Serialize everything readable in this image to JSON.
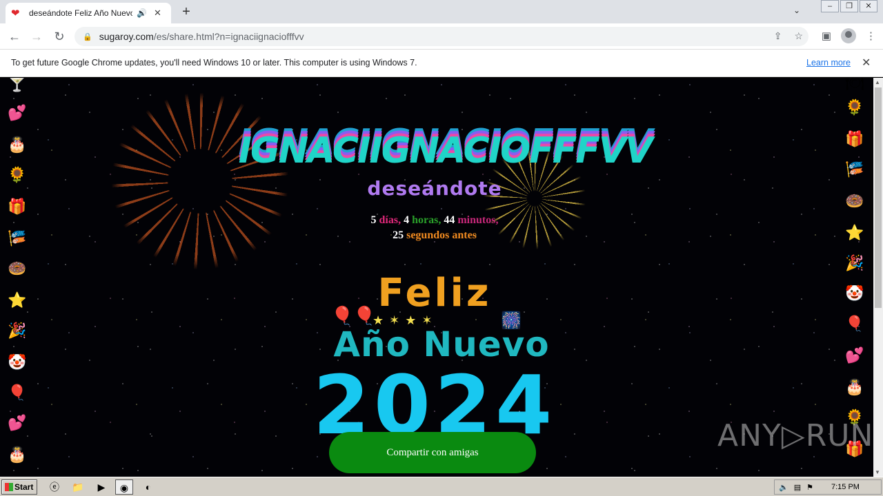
{
  "browser": {
    "tab_title": "deseándote Feliz Año Nuevo 20",
    "url_host": "sugaroy.com",
    "url_path": "/es/share.html?n=ignaciignaciofffvv"
  },
  "infobar": {
    "message": "To get future Google Chrome updates, you'll need Windows 10 or later. This computer is using Windows 7.",
    "link": "Learn more"
  },
  "page": {
    "headline": "IGNACIIGNACIOFFFVV",
    "subhead": "deseándote",
    "countdown": {
      "days": "5",
      "days_label": "días,",
      "hours": "4",
      "hours_label": "horas,",
      "minutes": "44",
      "minutes_label": "minutos,",
      "seconds": "25",
      "seconds_label": "segundos antes"
    },
    "greeting_line1": "Feliz",
    "greeting_line2": "Año Nuevo",
    "year": "2024",
    "share_button": "Compartir con amigas"
  },
  "watermark": "ANY▷RUN",
  "taskbar": {
    "start_label": "Start",
    "clock": "7:15 PM"
  },
  "colors": {
    "headline": "#20d4c8",
    "subhead": "#b07af0",
    "share_button": "#0a8a10",
    "year": "#18c8f0"
  }
}
